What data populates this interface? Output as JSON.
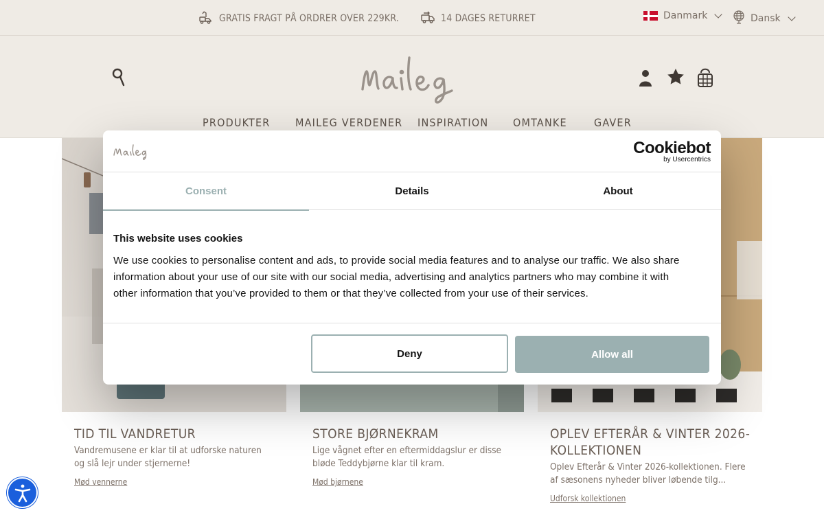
{
  "topbar": {
    "promo_shipping": "GRATIS FRAGT PÅ ORDRER OVER 229KR.",
    "promo_returns": "14 DAGES RETURRET",
    "country": "Danmark",
    "language": "Dansk"
  },
  "header": {
    "logo_text": "maileg",
    "nav": [
      "PRODUKTER",
      "MAILEG VERDENER",
      "INSPIRATION",
      "OMTANKE",
      "GAVER"
    ]
  },
  "cards": [
    {
      "title": "TID TIL VANDRETUR",
      "desc_lines": [
        "Vandremusene er klar til at udforske naturen",
        "og slå lejr under stjernerne!"
      ],
      "link": "Mød vennerne"
    },
    {
      "title": "STORE BJØRNEKRAM",
      "desc_lines": [
        "Lige vågnet efter en eftermiddagslur er disse",
        "bløde Teddybjørne klar til kram."
      ],
      "link": "Mød bjørnene"
    },
    {
      "title_lines": [
        "OPLEV EFTERÅR & VINTER 2026-",
        "KOLLEKTIONEN"
      ],
      "desc_lines": [
        "Oplev Efterår & Vinter 2026-kollektionen. Flere",
        "af sæsonens nyheder bliver løbende tilg..."
      ],
      "link": "Udforsk kollektionen"
    }
  ],
  "cookie_dialog": {
    "brand": "Cookiebot",
    "brand_sub": "by Usercentrics",
    "logo_text": "maileg",
    "tabs": [
      "Consent",
      "Details",
      "About"
    ],
    "active_tab": "Consent",
    "heading": "This website uses cookies",
    "body_lines": [
      "We use cookies to personalise content and ads, to provide social media features and to analyse our traffic. We also share",
      "information about your use of our site with our social media, advertising and analytics partners who may combine it with",
      "other information that you’ve provided to them or that they’ve collected from your use of their services."
    ],
    "deny_label": "Deny",
    "allow_label": "Allow all"
  },
  "colors": {
    "header_bg": "#efebe5",
    "text_brown": "#6a5e55",
    "accent_sage": "#9bb0b1",
    "flag_red": "#c8102e",
    "a11y_blue": "#1a5fdc"
  },
  "icons": [
    "shipping-truck-icon",
    "return-truck-icon",
    "denmark-flag-icon",
    "globe-icon",
    "chevron-down-icon",
    "search-icon",
    "account-icon",
    "wishlist-star-icon",
    "cart-bag-icon",
    "accessibility-icon"
  ]
}
